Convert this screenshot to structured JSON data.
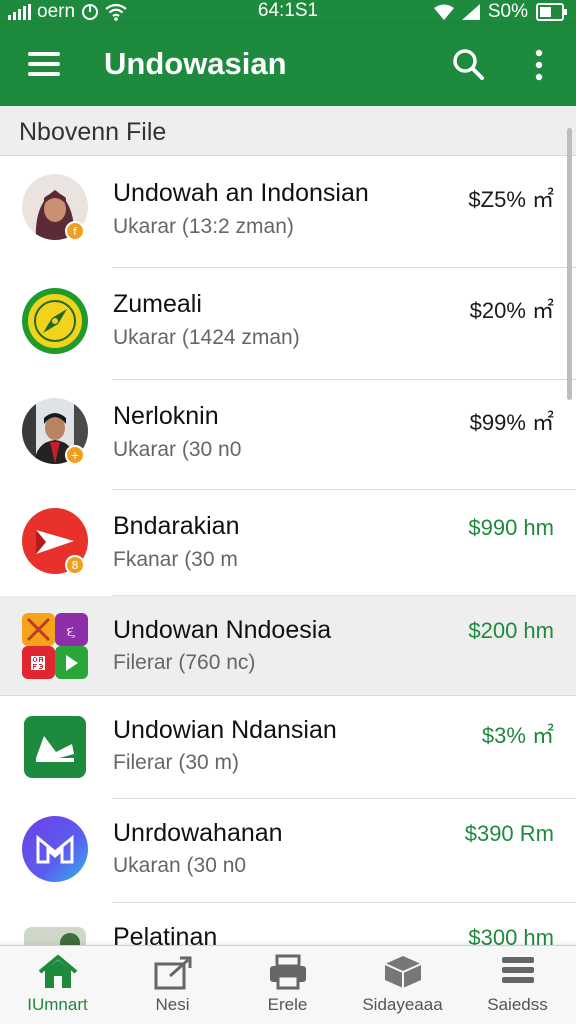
{
  "status_bar": {
    "carrier": "oern",
    "time": "64:1S1",
    "battery_text": "S0%"
  },
  "app_bar": {
    "title": "Undowasian",
    "menu_icon": "hamburger-menu-icon",
    "search_icon": "search-icon",
    "more_icon": "more-vertical-icon"
  },
  "section": {
    "header": "Nbovenn File"
  },
  "items": [
    {
      "name": "Undowah an Indonsian",
      "subtitle": "Ukarar  (13:2 zman)",
      "price": "$Z5% ㎡",
      "price_color": "#1b1b1b",
      "avatar": "woman-hijab-photo",
      "selected": false
    },
    {
      "name": "Zumeali",
      "subtitle": "Ukarar  (1424 zman)",
      "price": "$20% ㎡",
      "price_color": "#1b1b1b",
      "avatar": "compass-emblem-logo",
      "selected": false
    },
    {
      "name": "Nerloknin",
      "subtitle": "Ukarar  (30 n0",
      "price": "$99% ㎡",
      "price_color": "#1b1b1b",
      "avatar": "man-portrait-photo",
      "selected": false
    },
    {
      "name": "Bndarakian",
      "subtitle": "Fkanar  (30 m",
      "price": "$990 hm",
      "price_color": "#1e8a3d",
      "avatar": "red-arrow-app-icon",
      "selected": false
    },
    {
      "name": "Undowan Nndoesia",
      "subtitle": "Filerar  (760 nc)",
      "price": "$200 hm",
      "price_color": "#1e8a3d",
      "avatar": "multicolor-tiles-app-icon",
      "selected": true
    },
    {
      "name": "Undowian Ndansian",
      "subtitle": "Filerar  (30 m)",
      "price": "$3% ㎡",
      "price_color": "#1e8a3d",
      "avatar": "green-shoe-app-icon",
      "selected": false
    },
    {
      "name": "Unrdowahanan",
      "subtitle": "Ukaran  (30 n0",
      "price": "$390 Rm",
      "price_color": "#1e8a3d",
      "avatar": "purple-gradient-app-icon",
      "selected": false
    },
    {
      "name": "Pelatinan",
      "subtitle": "",
      "price": "$300 hm",
      "price_color": "#1e8a3d",
      "avatar": "partial-photo-icon",
      "selected": false
    }
  ],
  "bottom_nav": [
    {
      "label": "IUmnart",
      "icon": "home-icon",
      "active": true
    },
    {
      "label": "Nesi",
      "icon": "share-icon",
      "active": false
    },
    {
      "label": "Erele",
      "icon": "printer-icon",
      "active": false
    },
    {
      "label": "Sidayeaaa",
      "icon": "box-icon",
      "active": false
    },
    {
      "label": "Saiedss",
      "icon": "list-icon",
      "active": false
    }
  ],
  "colors": {
    "primary_green": "#1e8a3d",
    "selected_row_bg": "#eeeeee",
    "price_dark": "#1b1b1b"
  }
}
